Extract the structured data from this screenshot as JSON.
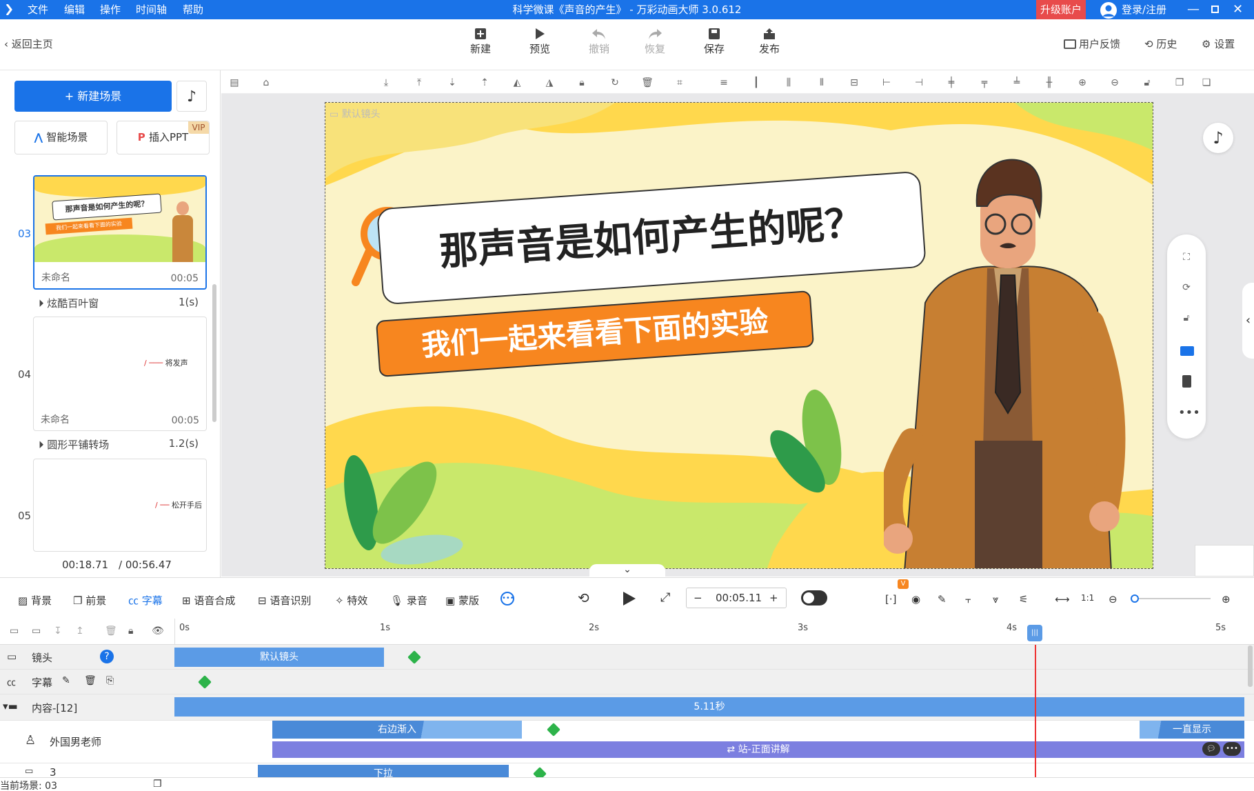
{
  "window": {
    "menu": [
      "文件",
      "编辑",
      "操作",
      "时间轴",
      "帮助"
    ],
    "title": "科学微课《声音的产生》 - 万彩动画大师 3.0.612",
    "upgrade": "升级账户",
    "login": "登录/注册"
  },
  "toolbar": {
    "back": "返回主页",
    "buttons": [
      {
        "label": "新建"
      },
      {
        "label": "预览"
      },
      {
        "label": "撤销"
      },
      {
        "label": "恢复"
      },
      {
        "label": "保存"
      },
      {
        "label": "发布"
      }
    ],
    "feedback": "用户反馈",
    "history": "历史",
    "settings": "设置"
  },
  "left": {
    "new_scene": "+ 新建场景",
    "smart_scene": "智能场景",
    "insert_ppt": "插入PPT",
    "vip": "VIP",
    "scenes": [
      {
        "num": "03",
        "name": "未命名",
        "dur": "00:05",
        "title": "那声音是如何产生的呢？",
        "sub": "我们一起来看看下面的实验"
      },
      {
        "num": "04",
        "name": "未命名",
        "dur": "00:05",
        "snippet": "将发声"
      },
      {
        "num": "05",
        "snippet": "松开手后"
      }
    ],
    "transitions": [
      {
        "name": "炫酷百叶窗",
        "dur": "1(s)"
      },
      {
        "name": "圆形平铺转场",
        "dur": "1.2(s)"
      }
    ],
    "time_cur": "00:18.71",
    "time_total": "/ 00:56.47"
  },
  "stage": {
    "camera": "默认镜头",
    "title": "那声音是如何产生的呢？",
    "subtitle": "我们一起来看看下面的实验"
  },
  "timeline": {
    "tools": [
      "背景",
      "前景",
      "字幕",
      "语音合成",
      "语音识别",
      "特效",
      "录音",
      "蒙版"
    ],
    "time": "00:05.11",
    "vbadge": "V",
    "ticks": [
      "0s",
      "1s",
      "2s",
      "3s",
      "4s",
      "5s"
    ],
    "tracks": {
      "camera": "镜头",
      "subtitle": "字幕",
      "content": "内容-[12]",
      "teacher": "外国男老师",
      "item3": "3"
    },
    "bars": {
      "camera": "默认镜头",
      "content": "5.11秒",
      "enter": "右边渐入",
      "always": "一直显示",
      "action": "站-正面讲解",
      "pull": "下拉"
    },
    "current_scene": "当前场景: 03"
  }
}
